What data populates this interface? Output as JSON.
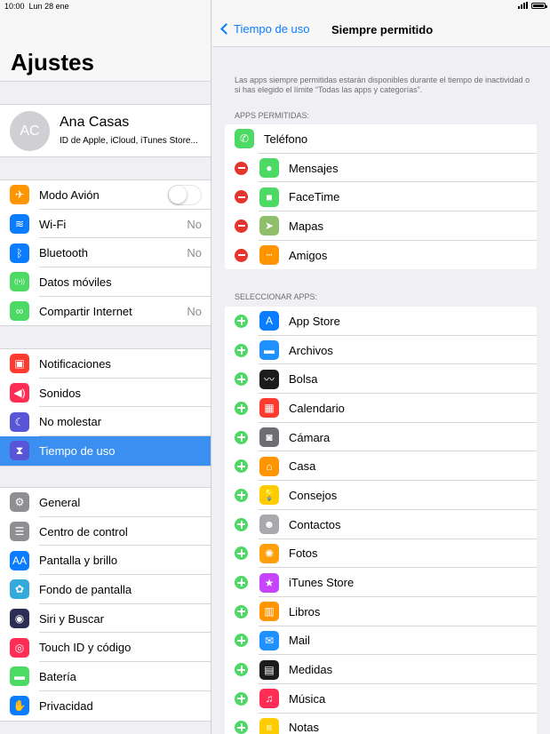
{
  "status": {
    "time": "10:00",
    "date": "Lun 28 ene"
  },
  "settings": {
    "title": "Ajustes",
    "profile": {
      "initials": "AC",
      "name": "Ana Casas",
      "subtitle": "ID de Apple, iCloud, iTunes Store..."
    },
    "groups": [
      {
        "items": [
          {
            "name": "modo-avion",
            "label": "Modo Avión",
            "icon": "airplane-icon",
            "glyph": "✈",
            "color": "#ff9500",
            "toggle": true
          },
          {
            "name": "wifi",
            "label": "Wi-Fi",
            "icon": "wifi-icon",
            "glyph": "≋",
            "color": "#0a7cff",
            "value": "No"
          },
          {
            "name": "bluetooth",
            "label": "Bluetooth",
            "icon": "bluetooth-icon",
            "glyph": "ᛒ",
            "color": "#0a7cff",
            "value": "No"
          },
          {
            "name": "datos-moviles",
            "label": "Datos móviles",
            "icon": "antenna-icon",
            "glyph": "((•))",
            "color": "#4cd964"
          },
          {
            "name": "compartir-internet",
            "label": "Compartir Internet",
            "icon": "link-icon",
            "glyph": "∞",
            "color": "#4cd964",
            "value": "No"
          }
        ]
      },
      {
        "items": [
          {
            "name": "notificaciones",
            "label": "Notificaciones",
            "icon": "notifications-icon",
            "glyph": "▣",
            "color": "#ff3b30"
          },
          {
            "name": "sonidos",
            "label": "Sonidos",
            "icon": "speaker-icon",
            "glyph": "◀)",
            "color": "#ff2d55"
          },
          {
            "name": "no-molestar",
            "label": "No molestar",
            "icon": "moon-icon",
            "glyph": "☾",
            "color": "#5856d6"
          },
          {
            "name": "tiempo-de-uso",
            "label": "Tiempo de uso",
            "icon": "hourglass-icon",
            "glyph": "⧗",
            "color": "#5856d6",
            "active": true
          }
        ]
      },
      {
        "items": [
          {
            "name": "general",
            "label": "General",
            "icon": "gear-icon",
            "glyph": "⚙",
            "color": "#8e8e93"
          },
          {
            "name": "centro-de-control",
            "label": "Centro de control",
            "icon": "switches-icon",
            "glyph": "☰",
            "color": "#8e8e93"
          },
          {
            "name": "pantalla-y-brillo",
            "label": "Pantalla y brillo",
            "icon": "text-size-icon",
            "glyph": "AA",
            "color": "#0a7cff"
          },
          {
            "name": "fondo-de-pantalla",
            "label": "Fondo de pantalla",
            "icon": "flower-icon",
            "glyph": "✿",
            "color": "#34aadc"
          },
          {
            "name": "siri-y-buscar",
            "label": "Siri y Buscar",
            "icon": "siri-icon",
            "glyph": "◉",
            "color": "#2c2c54"
          },
          {
            "name": "touch-id",
            "label": "Touch ID y código",
            "icon": "fingerprint-icon",
            "glyph": "◎",
            "color": "#ff2d55"
          },
          {
            "name": "bateria",
            "label": "Batería",
            "icon": "battery-icon",
            "glyph": "▬",
            "color": "#4cd964"
          },
          {
            "name": "privacidad",
            "label": "Privacidad",
            "icon": "hand-icon",
            "glyph": "✋",
            "color": "#0a7cff"
          }
        ]
      }
    ]
  },
  "detail": {
    "back_label": "Tiempo de uso",
    "title": "Siempre permitido",
    "description": "Las apps siempre permitidas estarán disponibles durante el tiempo de inactividad o si has elegido el límite “Todas las apps y categorías”.",
    "allowed_header": "APPS PERMITIDAS:",
    "allowed": [
      {
        "name": "telefono",
        "label": "Teléfono",
        "icon": "phone-icon",
        "glyph": "✆",
        "color": "#4cd964",
        "removable": false
      },
      {
        "name": "mensajes",
        "label": "Mensajes",
        "icon": "message-icon",
        "glyph": "●",
        "color": "#4cd964",
        "removable": true
      },
      {
        "name": "facetime",
        "label": "FaceTime",
        "icon": "video-icon",
        "glyph": "■",
        "color": "#4cd964",
        "removable": true
      },
      {
        "name": "mapas",
        "label": "Mapas",
        "icon": "map-icon",
        "glyph": "➤",
        "color": "#8fbf6a",
        "removable": true
      },
      {
        "name": "amigos",
        "label": "Amigos",
        "icon": "friends-icon",
        "glyph": "ⵈ",
        "color": "#ff9500",
        "removable": true
      }
    ],
    "select_header": "SELECCIONAR APPS:",
    "available": [
      {
        "name": "app-store",
        "label": "App Store",
        "icon": "app-store-icon",
        "glyph": "A",
        "color": "#0a7cff"
      },
      {
        "name": "archivos",
        "label": "Archivos",
        "icon": "folder-icon",
        "glyph": "▬",
        "color": "#1e90ff"
      },
      {
        "name": "bolsa",
        "label": "Bolsa",
        "icon": "stocks-icon",
        "glyph": "〰",
        "color": "#1c1c1e"
      },
      {
        "name": "calendario",
        "label": "Calendario",
        "icon": "calendar-icon",
        "glyph": "▦",
        "color": "#ff3b30"
      },
      {
        "name": "camara",
        "label": "Cámara",
        "icon": "camera-icon",
        "glyph": "◙",
        "color": "#6d6d72"
      },
      {
        "name": "casa",
        "label": "Casa",
        "icon": "home-icon",
        "glyph": "⌂",
        "color": "#ff9500"
      },
      {
        "name": "consejos",
        "label": "Consejos",
        "icon": "lightbulb-icon",
        "glyph": "💡",
        "color": "#ffcc00"
      },
      {
        "name": "contactos",
        "label": "Contactos",
        "icon": "contacts-icon",
        "glyph": "☻",
        "color": "#a8a8ad"
      },
      {
        "name": "fotos",
        "label": "Fotos",
        "icon": "photos-icon",
        "glyph": "✺",
        "color": "#ff9f0a"
      },
      {
        "name": "itunes-store",
        "label": "iTunes Store",
        "icon": "star-icon",
        "glyph": "★",
        "color": "#c644fc"
      },
      {
        "name": "libros",
        "label": "Libros",
        "icon": "book-icon",
        "glyph": "▥",
        "color": "#ff9500"
      },
      {
        "name": "mail",
        "label": "Mail",
        "icon": "mail-icon",
        "glyph": "✉",
        "color": "#1e90ff"
      },
      {
        "name": "medidas",
        "label": "Medidas",
        "icon": "ruler-icon",
        "glyph": "▤",
        "color": "#1c1c1e"
      },
      {
        "name": "musica",
        "label": "Música",
        "icon": "music-icon",
        "glyph": "♫",
        "color": "#ff2d55"
      },
      {
        "name": "notas",
        "label": "Notas",
        "icon": "notes-icon",
        "glyph": "≡",
        "color": "#ffcc00"
      }
    ]
  }
}
